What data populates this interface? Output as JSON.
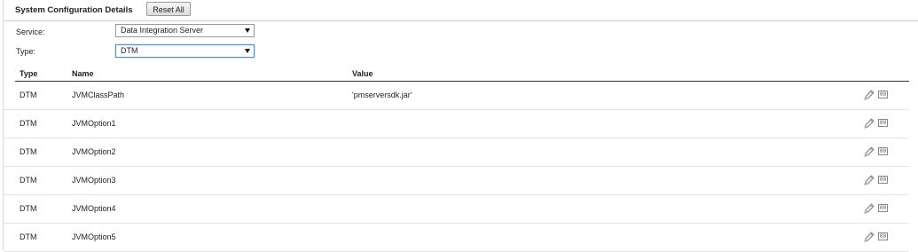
{
  "header": {
    "title": "System Configuration Details",
    "reset_label": "Reset All"
  },
  "filters": {
    "service_label": "Service:",
    "service_value": "Data Integration Server",
    "type_label": "Type:",
    "type_value": "DTM"
  },
  "table": {
    "columns": [
      "Type",
      "Name",
      "Value"
    ],
    "rows": [
      {
        "type": "DTM",
        "name": "JVMClassPath",
        "value": "'pmserversdk.jar'"
      },
      {
        "type": "DTM",
        "name": "JVMOption1",
        "value": ""
      },
      {
        "type": "DTM",
        "name": "JVMOption2",
        "value": ""
      },
      {
        "type": "DTM",
        "name": "JVMOption3",
        "value": ""
      },
      {
        "type": "DTM",
        "name": "JVMOption4",
        "value": ""
      },
      {
        "type": "DTM",
        "name": "JVMOption5",
        "value": ""
      }
    ],
    "row_actions": {
      "edit_icon": "pencil-icon",
      "expression_icon": "expression-icon",
      "expression_glyph": "00"
    }
  },
  "colors": {
    "focus": "#4a90d9",
    "border": "#9a9a9a"
  }
}
